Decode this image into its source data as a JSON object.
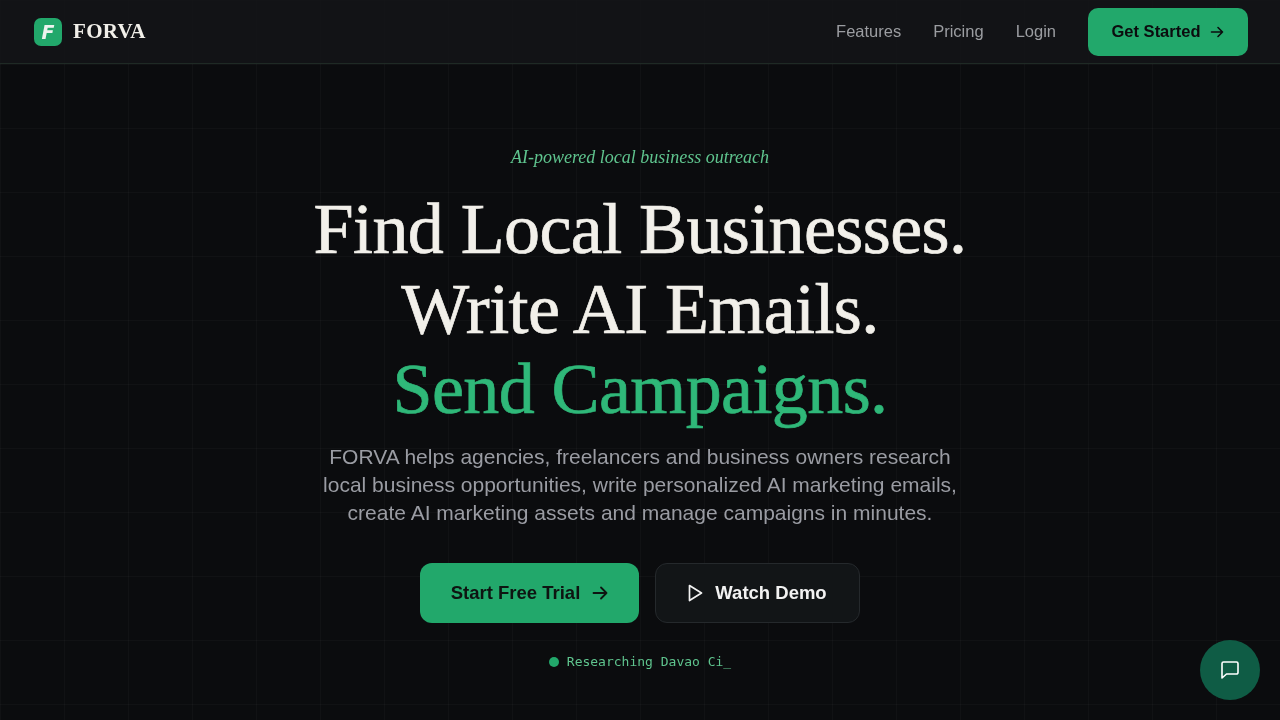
{
  "header": {
    "logo_mark": "F",
    "brand": "FORVA",
    "nav": [
      "Features",
      "Pricing",
      "Login"
    ],
    "cta": "Get Started"
  },
  "hero": {
    "tagline": "AI-powered local business outreach",
    "headline": [
      {
        "text": "Find Local Businesses.",
        "accent": false
      },
      {
        "text": "Write AI Emails.",
        "accent": false
      },
      {
        "text": "Send Campaigns.",
        "accent": true
      }
    ],
    "description": "FORVA helps agencies, freelancers and business owners research local business opportunities, write personalized AI marketing emails, create AI marketing assets and manage campaigns in minutes.",
    "buttons": [
      {
        "label": "Start Free Trial",
        "kind": "primary"
      },
      {
        "label": "Watch Demo",
        "kind": "secondary"
      }
    ],
    "status": "Researching Davao Ci_"
  }
}
